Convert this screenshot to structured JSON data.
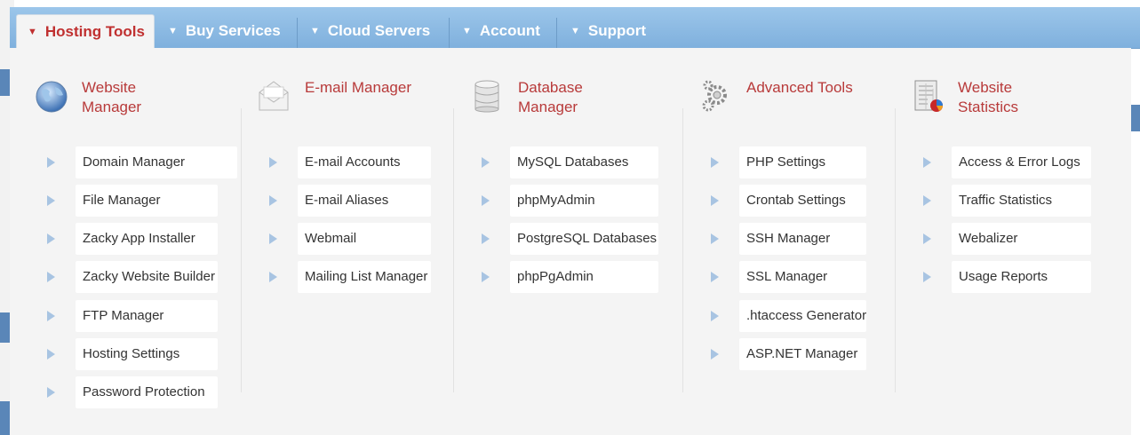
{
  "menu": {
    "tabs": [
      {
        "label": "Hosting Tools",
        "arrow": "▼"
      },
      {
        "label": "Buy Services",
        "arrow": "▼"
      },
      {
        "label": "Cloud Servers",
        "arrow": "▼"
      },
      {
        "label": "Account",
        "arrow": "▼"
      },
      {
        "label": "Support",
        "arrow": "▼"
      }
    ],
    "active_color": "#c03030",
    "bar_color": "#8dbbe3"
  },
  "columns": [
    {
      "title_line1": "Website",
      "title_line2": "Manager",
      "icon": "globe-icon",
      "items": [
        "Domain Manager",
        "File Manager",
        "Zacky App Installer",
        "Zacky Website Builder",
        "FTP Manager",
        "Hosting Settings",
        "Password Protection"
      ]
    },
    {
      "title_line1": "E-mail Manager",
      "title_line2": "",
      "icon": "envelope-icon",
      "items": [
        "E-mail Accounts",
        "E-mail Aliases",
        "Webmail",
        "Mailing List Manager"
      ]
    },
    {
      "title_line1": "Database",
      "title_line2": "Manager",
      "icon": "database-icon",
      "items": [
        "MySQL Databases",
        "phpMyAdmin",
        "PostgreSQL Databases",
        "phpPgAdmin"
      ]
    },
    {
      "title_line1": "Advanced Tools",
      "title_line2": "",
      "icon": "gears-icon",
      "items": [
        "PHP Settings",
        "Crontab Settings",
        "SSH Manager",
        "SSL Manager",
        ".htaccess Generator",
        "ASP.NET Manager"
      ]
    },
    {
      "title_line1": "Website",
      "title_line2": "Statistics",
      "icon": "stats-report-icon",
      "items": [
        "Access & Error Logs",
        "Traffic Statistics",
        "Webalizer",
        "Usage Reports"
      ]
    }
  ]
}
